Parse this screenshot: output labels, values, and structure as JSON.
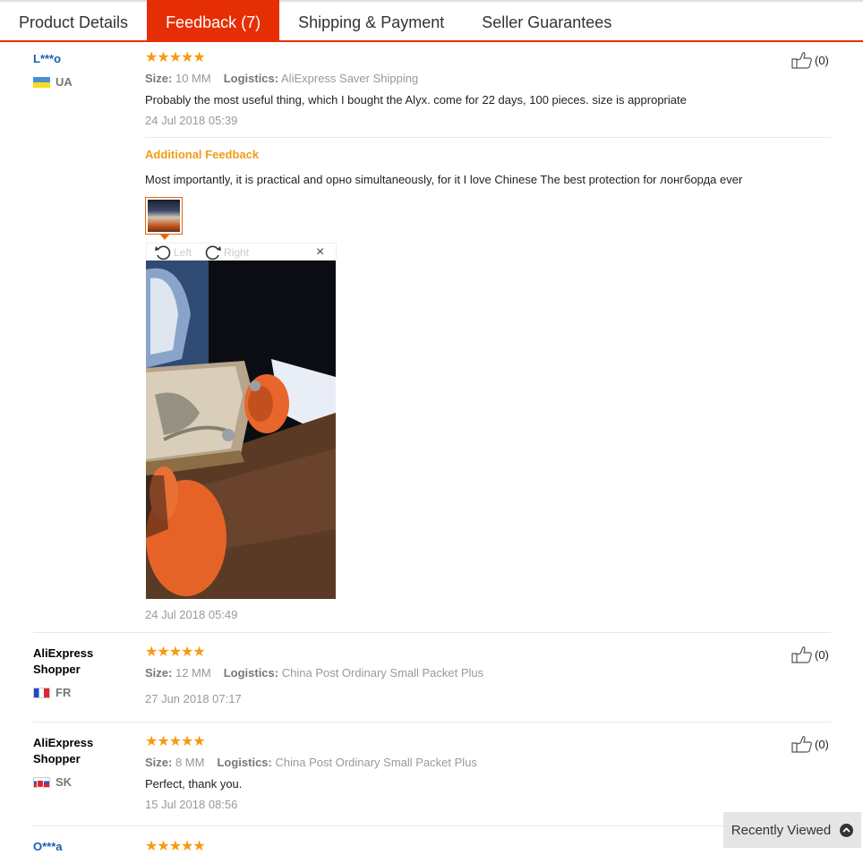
{
  "tabs": [
    {
      "label": "Product Details"
    },
    {
      "label": "Feedback (7)"
    },
    {
      "label": "Shipping & Payment"
    },
    {
      "label": "Seller Guarantees"
    }
  ],
  "active_tab_index": 1,
  "labels": {
    "size": "Size:",
    "logistics": "Logistics:",
    "additional_feedback": "Additional Feedback",
    "rotate_left": "Left",
    "rotate_right": "Right",
    "close": "×"
  },
  "reviews": [
    {
      "user": "L***o",
      "country": "UA",
      "stars": "★★★★★",
      "size": "10 MM",
      "logistics": "AliExpress Saver Shipping",
      "text": "Probably the most useful thing, which I bought the Alyx. come for 22 days, 100 pieces. size is appropriate",
      "date": "24 Jul 2018 05:39",
      "likes": "(0)",
      "additional": {
        "text": "Most importantly, it is practical and орно simultaneously, for it I love Chinese The best protection for лонгборда ever",
        "date": "24 Jul 2018 05:49"
      }
    },
    {
      "user": "AliExpress Shopper",
      "user_line1": "AliExpress",
      "user_line2": "Shopper",
      "country": "FR",
      "stars": "★★★★★",
      "size": "12 MM",
      "logistics": "China Post Ordinary Small Packet Plus",
      "date": "27 Jun 2018 07:17",
      "likes": "(0)"
    },
    {
      "user": "AliExpress Shopper",
      "user_line1": "AliExpress",
      "user_line2": "Shopper",
      "country": "SK",
      "stars": "★★★★★",
      "size": "8 MM",
      "logistics": "China Post Ordinary Small Packet Plus",
      "text": "Perfect, thank you.",
      "date": "15 Jul 2018 08:56",
      "likes": "(0)"
    },
    {
      "user": "O***a",
      "stars": "★★★★★"
    }
  ],
  "recently_viewed": "Recently Viewed",
  "colors": {
    "accent": "#e62e04",
    "star": "#f79b0e",
    "additional": "#f29c16",
    "link": "#1a5db6"
  }
}
